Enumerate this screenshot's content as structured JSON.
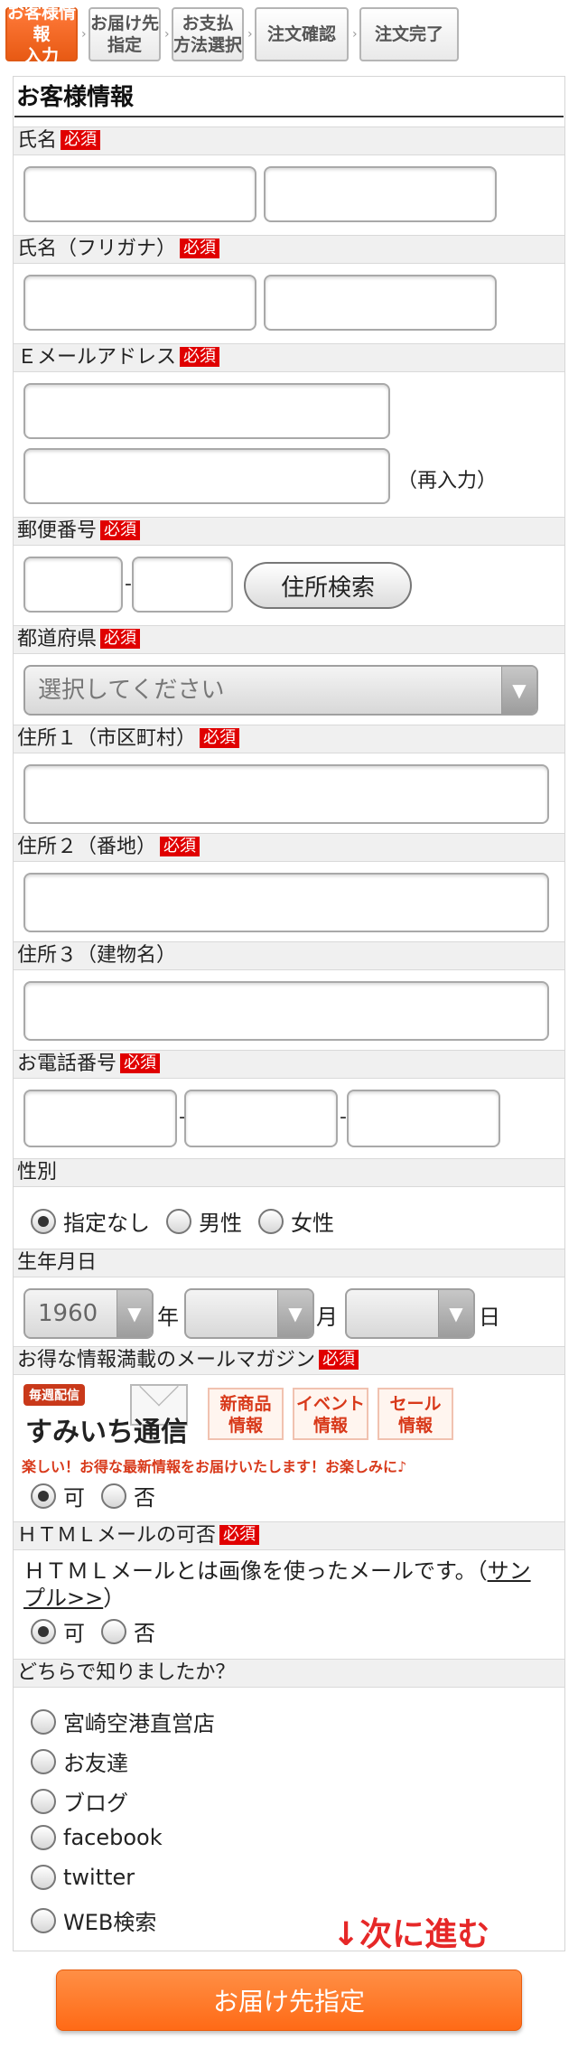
{
  "steps": [
    {
      "label": "お客様情報\n入力",
      "active": true
    },
    {
      "label": "お届け先\n指定",
      "active": false
    },
    {
      "label": "お支払\n方法選択",
      "active": false
    },
    {
      "label": "注文確認",
      "active": false
    },
    {
      "label": "注文完了",
      "active": false
    }
  ],
  "form_title": "お客様情報",
  "required_label": "必須",
  "fields": {
    "name": {
      "label": "氏名"
    },
    "name_kana": {
      "label": "氏名（フリガナ）"
    },
    "email": {
      "label": "Ｅメールアドレス",
      "reenter_note": "（再入力）"
    },
    "postal": {
      "label": "郵便番号",
      "search_button": "住所検索"
    },
    "prefecture": {
      "label": "都道府県",
      "placeholder": "選択してください"
    },
    "address1": {
      "label": "住所１（市区町村）"
    },
    "address2": {
      "label": "住所２（番地）"
    },
    "address3": {
      "label": "住所３（建物名）"
    },
    "phone": {
      "label": "お電話番号"
    },
    "gender": {
      "label": "性別",
      "options": [
        "指定なし",
        "男性",
        "女性"
      ],
      "selected": "指定なし"
    },
    "birthdate": {
      "label": "生年月日",
      "year_value": "1960",
      "year_unit": "年",
      "month_unit": "月",
      "day_unit": "日"
    },
    "magazine": {
      "label": "お得な情報満載のメールマガジン",
      "banner_badge": "毎週配信",
      "banner_name": "すみいち通信",
      "banner_tags": [
        "新商品\n情報",
        "イベント\n情報",
        "セール\n情報"
      ],
      "banner_tagline": "楽しい！お得な最新情報をお届けいたします！お楽しみに♪",
      "options": [
        "可",
        "否"
      ],
      "selected": "可"
    },
    "html_mail": {
      "label": "ＨＴＭＬメールの可否",
      "description": "ＨＴＭＬメールとは画像を使ったメールです。（",
      "sample_link": "サンプル>>",
      "description_end": "）",
      "options": [
        "可",
        "否"
      ],
      "selected": "可"
    },
    "referral": {
      "label": "どちらで知りましたか？",
      "options": [
        "宮崎空港直営店",
        "お友達",
        "ブログ",
        "facebook",
        "twitter",
        "WEB検索"
      ]
    }
  },
  "next_hint": "↓次に進む",
  "next_button": "お届け先指定",
  "colors": {
    "accent": "#ff6a16",
    "required": "#e00000",
    "hint": "#e62828"
  }
}
